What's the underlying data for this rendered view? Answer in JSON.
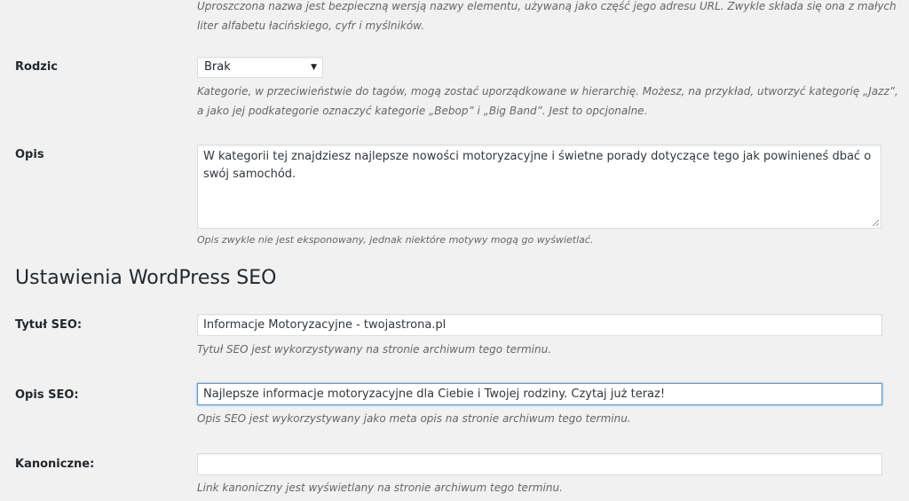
{
  "slug": {
    "description": "Uproszczona nazwa jest bezpieczną wersją nazwy elementu, używaną jako część jego adresu URL. Zwykle składa się ona z małych liter alfabetu łacińskiego, cyfr i myślników."
  },
  "parent": {
    "label": "Rodzic",
    "selected": "Brak",
    "description": "Kategorie, w przeciwieństwie do tagów, mogą zostać uporządkowane w hierarchię. Możesz, na przykład, utworzyć kategorię „Jazz”, a jako jej podkategorie oznaczyć kategorie „Bebop” i „Big Band”. Jest to opcjonalne."
  },
  "description_field": {
    "label": "Opis",
    "value": "W kategorii tej znajdziesz najlepsze nowości motoryzacyjne i świetne porady dotyczące tego jak powinieneś dbać o swój samochód.",
    "help": "Opis zwykle nie jest eksponowany, jednak niektóre motywy mogą go wyświetlać."
  },
  "seo": {
    "section_title": "Ustawienia WordPress SEO",
    "title": {
      "label": "Tytuł SEO:",
      "value": "Informacje Motoryzacyjne - twojastrona.pl",
      "help": "Tytuł SEO jest wykorzystywany na stronie archiwum tego terminu."
    },
    "description": {
      "label": "Opis SEO:",
      "value": "Najlepsze informacje motoryzacyjne dla Ciebie i Twojej rodziny. Czytaj już teraz!",
      "help": "Opis SEO jest wykorzystywany jako meta opis na stronie archiwum tego terminu."
    },
    "canonical": {
      "label": "Kanoniczne:",
      "value": "",
      "help": "Link kanoniczny jest wyświetlany na stronie archiwum tego terminu."
    }
  }
}
